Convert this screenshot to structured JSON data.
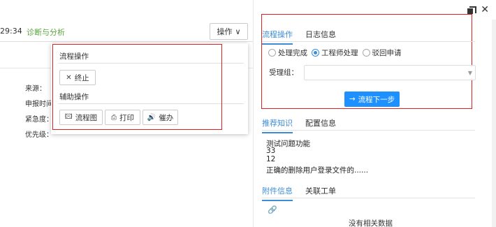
{
  "window": {
    "restore_icon": "restore-icon",
    "close_glyph": "✕"
  },
  "left": {
    "time": "29:34",
    "diag_link": "诊断与分析",
    "op_button": {
      "label": "操作",
      "arrow": "∨"
    },
    "fields": [
      "来源：",
      "申报时间",
      "紧急度：",
      "优先级："
    ]
  },
  "dropdown": {
    "section1": "流程操作",
    "terminate": {
      "icon": "✕",
      "label": "终止"
    },
    "section2": "辅助操作",
    "flowchart": {
      "icon": "🖾",
      "label": "流程图"
    },
    "print": {
      "icon": "⎙",
      "label": "打印"
    },
    "urge": {
      "icon": "🔊",
      "label": "催办"
    }
  },
  "right": {
    "top_tabs": [
      "流程操作",
      "日志信息"
    ],
    "radios": [
      {
        "label": "处理完成",
        "checked": false
      },
      {
        "label": "工程师处理",
        "checked": true
      },
      {
        "label": "驳回申请",
        "checked": false
      }
    ],
    "group_label": "受理组：",
    "next_button": {
      "icon": "→",
      "label": "流程下一步"
    },
    "mid_tabs": [
      "推荐知识",
      "配置信息"
    ],
    "knowledge": [
      "测试问题功能",
      "33",
      "12",
      "正确的删除用户登录文件的......"
    ],
    "bottom_tabs": [
      "附件信息",
      "关联工单"
    ],
    "no_data": "没有相关数据"
  },
  "colors": {
    "accent": "#3c8dd7",
    "button_blue": "#1e90ff",
    "link_green": "#5aa63e",
    "highlight_red": "#e02020"
  }
}
